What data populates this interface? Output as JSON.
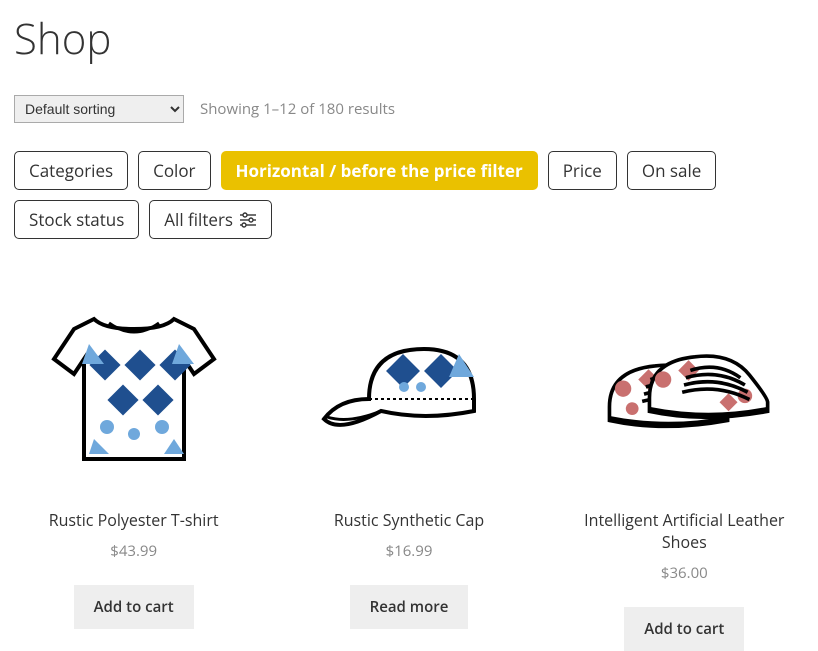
{
  "page_title": "Shop",
  "sorting": {
    "selected": "Default sorting"
  },
  "results_count": "Showing 1–12 of 180 results",
  "filters": [
    {
      "label": "Categories",
      "active": false
    },
    {
      "label": "Color",
      "active": false
    },
    {
      "label": "Horizontal / before the price filter",
      "active": true
    },
    {
      "label": "Price",
      "active": false
    },
    {
      "label": "On sale",
      "active": false
    },
    {
      "label": "Stock status",
      "active": false
    },
    {
      "label": "All filters",
      "active": false,
      "icon": "sliders"
    }
  ],
  "products": [
    {
      "title": "Rustic Polyester T-shirt",
      "price": "$43.99",
      "action": "Add to cart",
      "image": "tshirt"
    },
    {
      "title": "Rustic Synthetic Cap",
      "price": "$16.99",
      "action": "Read more",
      "image": "cap"
    },
    {
      "title": "Intelligent Artificial Leather Shoes",
      "price": "$36.00",
      "action": "Add to cart",
      "image": "shoes"
    }
  ]
}
